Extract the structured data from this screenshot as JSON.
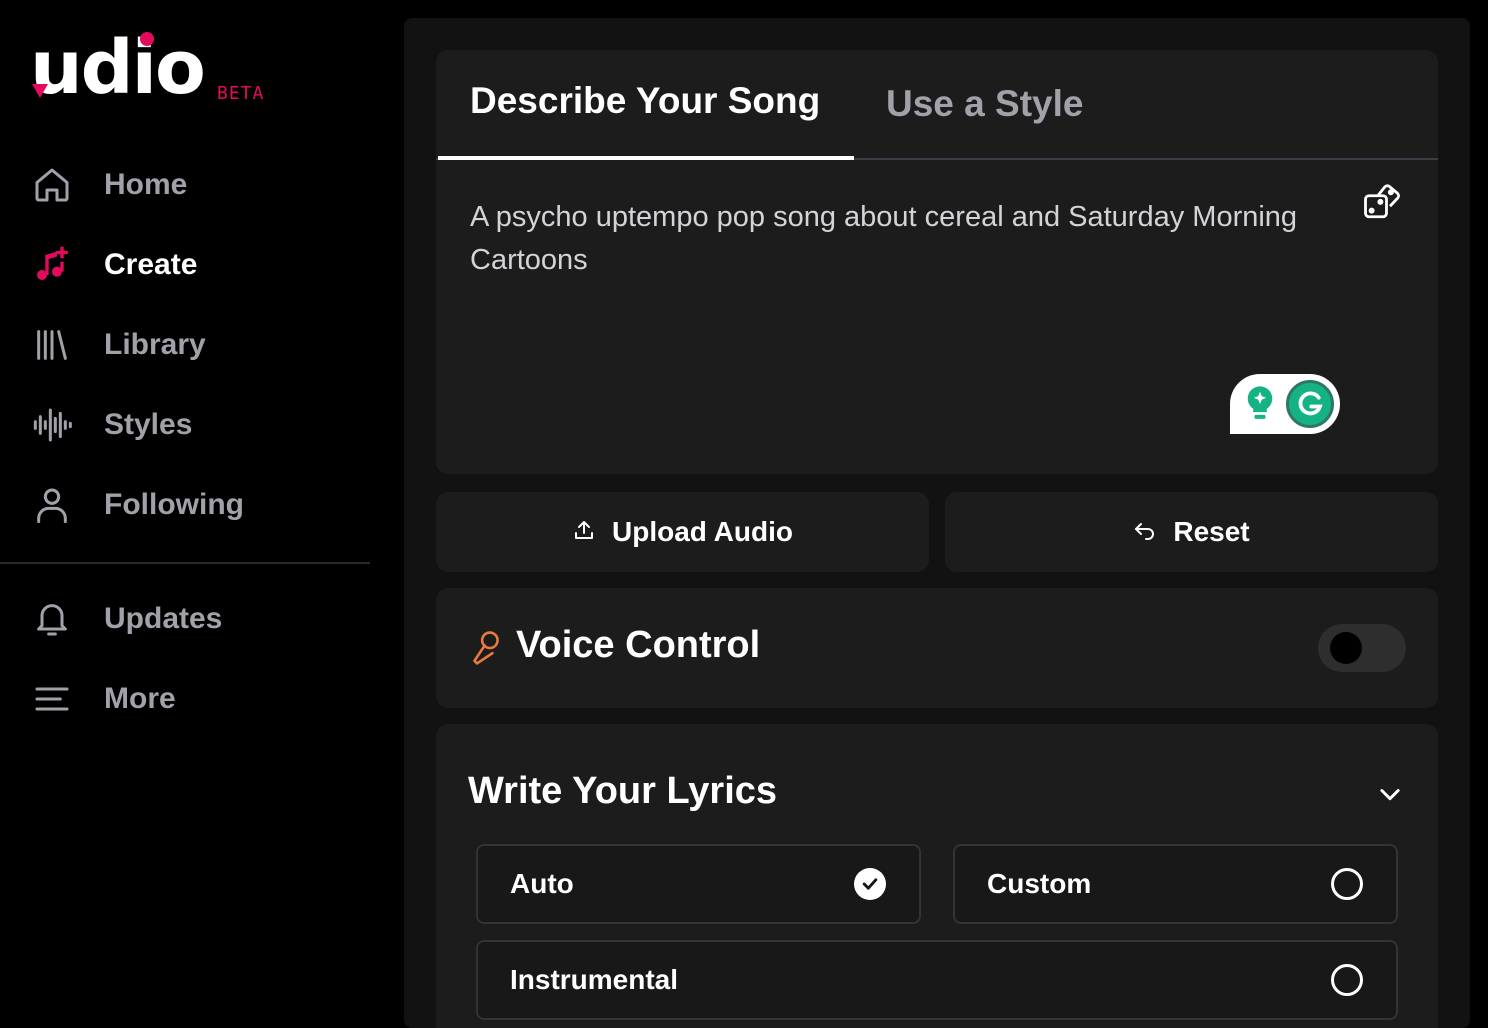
{
  "brand": {
    "logo_text": "udio",
    "badge": "BETA",
    "accent_color": "#e30b5d"
  },
  "sidebar": {
    "items": [
      {
        "label": "Home",
        "icon": "home-icon"
      },
      {
        "label": "Create",
        "icon": "music-plus-icon",
        "active": true
      },
      {
        "label": "Library",
        "icon": "library-icon"
      },
      {
        "label": "Styles",
        "icon": "waveform-icon"
      },
      {
        "label": "Following",
        "icon": "user-icon"
      }
    ],
    "secondary_items": [
      {
        "label": "Updates",
        "icon": "bell-icon"
      },
      {
        "label": "More",
        "icon": "menu-icon"
      }
    ]
  },
  "prompt": {
    "tabs": [
      {
        "label": "Describe Your Song",
        "active": true
      },
      {
        "label": "Use a Style",
        "active": false
      }
    ],
    "text": "A psycho uptempo pop song about cereal and Saturday Morning Cartoons",
    "random_icon": "dice-icon",
    "grammarly_widget": "grammarly-icon"
  },
  "actions": {
    "upload_label": "Upload Audio",
    "reset_label": "Reset"
  },
  "voice_control": {
    "title": "Voice Control",
    "icon": "microphone-icon",
    "enabled": false
  },
  "lyrics": {
    "title": "Write Your Lyrics",
    "options": [
      {
        "label": "Auto",
        "selected": true
      },
      {
        "label": "Custom",
        "selected": false
      },
      {
        "label": "Instrumental",
        "selected": false
      }
    ]
  }
}
